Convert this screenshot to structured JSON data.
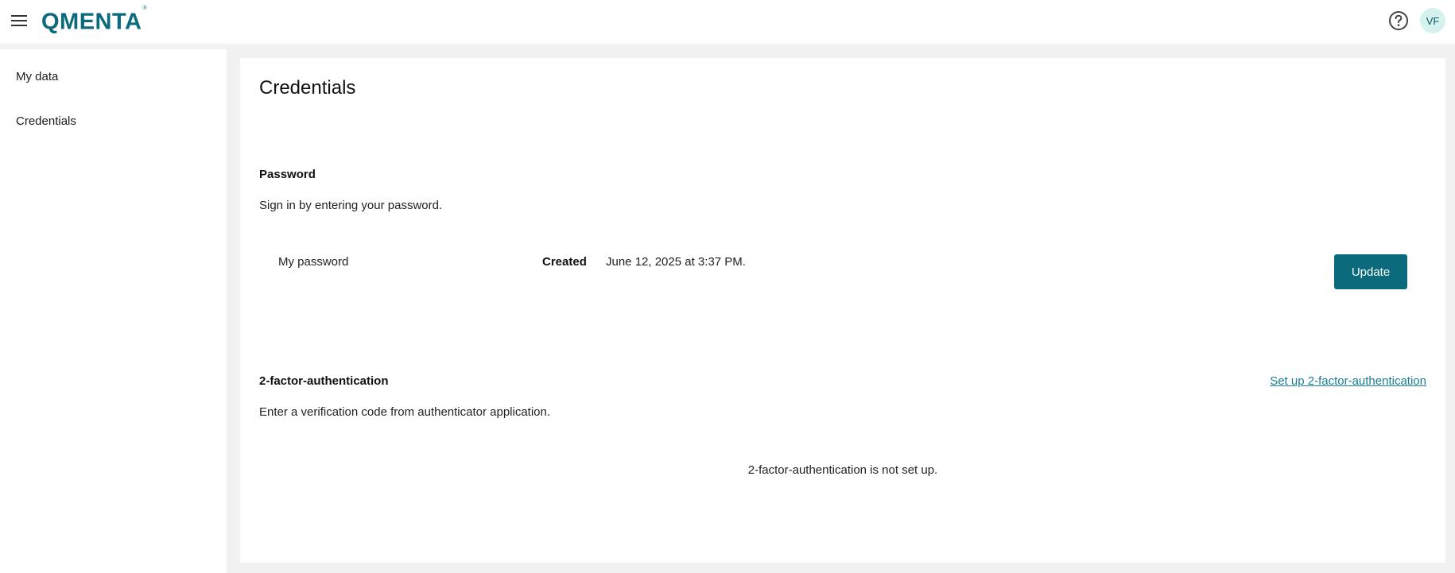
{
  "header": {
    "logo_text": "QMENTA",
    "logo_mark": "®",
    "avatar_initials": "VF",
    "icons": [
      "hamburger-menu-icon",
      "help-circle-icon"
    ]
  },
  "sidebar": {
    "items": [
      {
        "label": "My data"
      },
      {
        "label": "Credentials"
      }
    ]
  },
  "main": {
    "title": "Credentials",
    "password": {
      "title": "Password",
      "description": "Sign in by entering your password.",
      "name": "My password",
      "created_label": "Created",
      "created_value": "June 12, 2025 at 3:37 PM.",
      "update_label": "Update"
    },
    "two_factor": {
      "title": "2-factor-authentication",
      "description": "Enter a verification code from authenticator application.",
      "setup_link": "Set up 2-factor-authentication",
      "status": "2-factor-authentication is not set up."
    }
  },
  "colors": {
    "brand": "#0b6b7c",
    "link": "#1a7f92",
    "avatar_bg": "#d5f2ee",
    "page_bg": "#f1f1f1"
  }
}
